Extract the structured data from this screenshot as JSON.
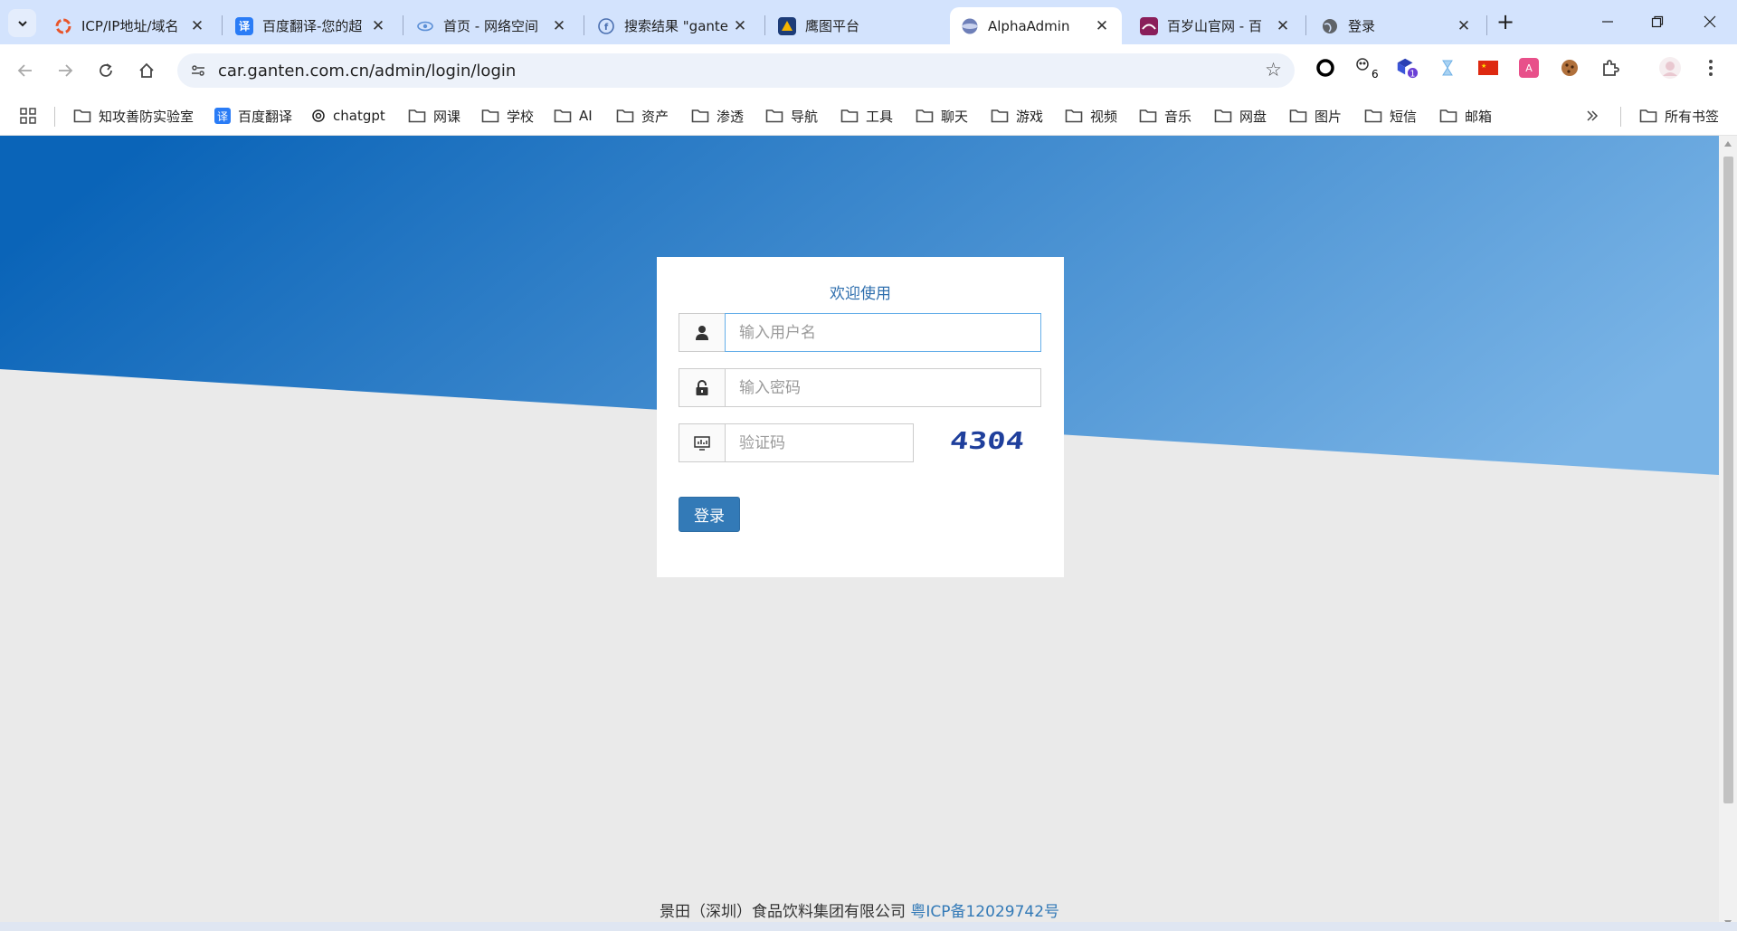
{
  "tabs": [
    {
      "title": "ICP/IP地址/域名",
      "favicon": "icp-favicon",
      "color": "#e8552a"
    },
    {
      "title": "百度翻译-您的超",
      "favicon": "baidu-translate-favicon",
      "color": "#2a7cf6",
      "glyph": "译"
    },
    {
      "title": "首页 - 网络空间",
      "favicon": "eye-favicon",
      "color": "#5b8fd6"
    },
    {
      "title": "搜索结果 \"gante",
      "favicon": "fofa-favicon",
      "color": "#4a6fb0"
    },
    {
      "title": "鹰图平台",
      "favicon": "hunter-favicon",
      "color": "#f5b400"
    },
    {
      "title": "AlphaAdmin",
      "favicon": "alphaadmin-favicon",
      "color": "#6e7fb8",
      "active": true
    },
    {
      "title": "百岁山官网 - 百",
      "favicon": "baisuishan-favicon",
      "color": "#8a1e5a"
    },
    {
      "title": "登录",
      "favicon": "globe-favicon",
      "color": "#5f6368"
    }
  ],
  "toolbar": {
    "url": "car.ganten.com.cn/admin/login/login"
  },
  "extensions": {
    "badge_6": "6",
    "badge_1": "1"
  },
  "bookmarks": [
    {
      "label": "知攻善防实验室",
      "icon": "folder"
    },
    {
      "label": "百度翻译",
      "icon": "baidu-translate"
    },
    {
      "label": "chatgpt",
      "icon": "chatgpt"
    },
    {
      "label": "网课",
      "icon": "folder"
    },
    {
      "label": "学校",
      "icon": "folder"
    },
    {
      "label": "AI",
      "icon": "folder"
    },
    {
      "label": "资产",
      "icon": "folder"
    },
    {
      "label": "渗透",
      "icon": "folder"
    },
    {
      "label": "导航",
      "icon": "folder"
    },
    {
      "label": "工具",
      "icon": "folder"
    },
    {
      "label": "聊天",
      "icon": "folder"
    },
    {
      "label": "游戏",
      "icon": "folder"
    },
    {
      "label": "视频",
      "icon": "folder"
    },
    {
      "label": "音乐",
      "icon": "folder"
    },
    {
      "label": "网盘",
      "icon": "folder"
    },
    {
      "label": "图片",
      "icon": "folder"
    },
    {
      "label": "短信",
      "icon": "folder"
    },
    {
      "label": "邮箱",
      "icon": "folder"
    }
  ],
  "all_bookmarks": "所有书签",
  "login": {
    "title": "欢迎使用",
    "username_placeholder": "输入用户名",
    "password_placeholder": "输入密码",
    "captcha_placeholder": "验证码",
    "captcha_text": "4304",
    "submit_label": "登录"
  },
  "footer": {
    "company": "景田（深圳）食品饮料集团有限公司 ",
    "icp": "粤ICP备12029742号"
  },
  "colors": {
    "hero_start": "#0a64b8",
    "hero_end": "#7ab4e6",
    "accent": "#337ab7"
  }
}
